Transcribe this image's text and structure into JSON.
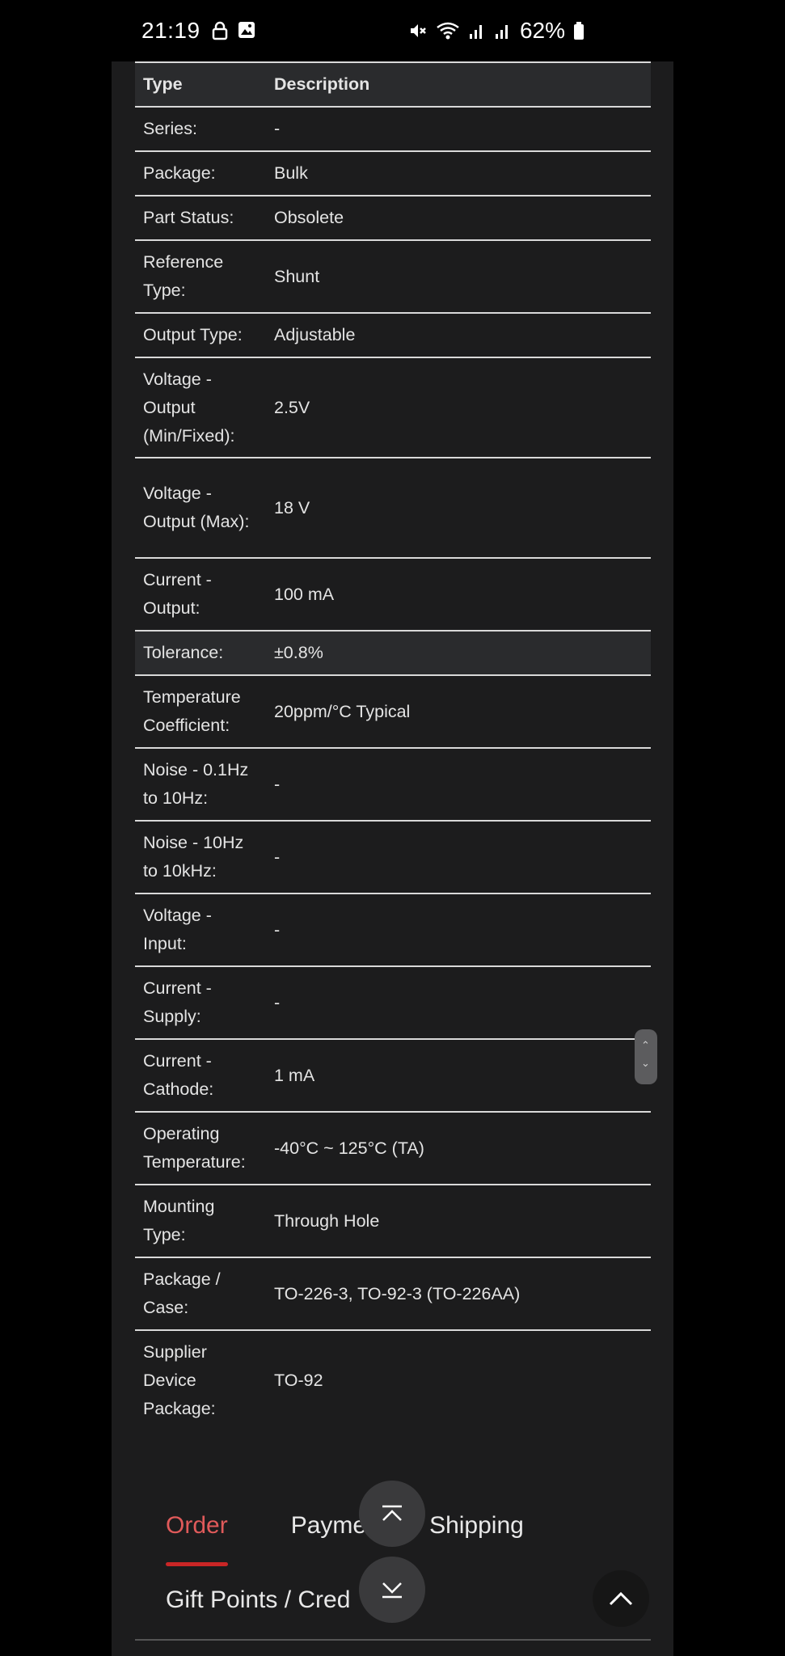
{
  "status_bar": {
    "time": "21:19",
    "battery": "62%"
  },
  "table": {
    "headers": {
      "type": "Type",
      "description": "Description"
    },
    "rows": [
      {
        "k": "Series:",
        "v": "-"
      },
      {
        "k": "Package:",
        "v": "Bulk"
      },
      {
        "k": "Part Status:",
        "v": "Obsolete"
      },
      {
        "k": "Reference Type:",
        "v": "Shunt"
      },
      {
        "k": "Output Type:",
        "v": "Adjustable"
      },
      {
        "k": "Voltage - Output (Min/Fixed):",
        "v": "2.5V"
      },
      {
        "k": "Voltage - Output (Max):",
        "v": "18 V"
      },
      {
        "k": "Current - Output:",
        "v": "100 mA"
      },
      {
        "k": "Tolerance:",
        "v": "±0.8%"
      },
      {
        "k": "Temperature Coefficient:",
        "v": "20ppm/°C Typical"
      },
      {
        "k": "Noise - 0.1Hz to 10Hz:",
        "v": "-"
      },
      {
        "k": "Noise - 10Hz to 10kHz:",
        "v": "-"
      },
      {
        "k": "Voltage - Input:",
        "v": "-"
      },
      {
        "k": "Current - Supply:",
        "v": "-"
      },
      {
        "k": "Current - Cathode:",
        "v": "1 mA"
      },
      {
        "k": "Operating Temperature:",
        "v": "-40°C ~ 125°C (TA)"
      },
      {
        "k": "Mounting Type:",
        "v": "Through Hole"
      },
      {
        "k": "Package / Case:",
        "v": "TO-226-3, TO-92-3 (TO-226AA)"
      },
      {
        "k": "Supplier Device Package:",
        "v": "TO-92"
      }
    ]
  },
  "tabs": [
    "Order",
    "Payme",
    "Shipping"
  ],
  "accordion": {
    "title": "Gift Points / Cred"
  },
  "icons": {
    "mute": "mute-icon",
    "wifi": "wifi-icon",
    "signal": "signal-icon",
    "battery": "battery-icon",
    "lock": "lock-icon",
    "gallery": "gallery-icon",
    "fab_up": "scroll-to-top-icon",
    "fab_down": "scroll-to-bottom-icon",
    "back_top": "chevron-up-icon"
  },
  "colors": {
    "accent": "#c92626",
    "background": "#1c1c1d"
  }
}
